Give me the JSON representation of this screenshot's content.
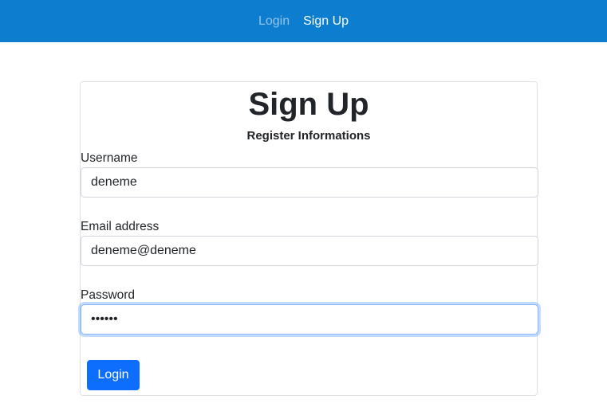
{
  "nav": {
    "login_label": "Login",
    "signup_label": "Sign Up"
  },
  "form": {
    "title": "Sign Up",
    "subtitle": "Register Informations",
    "username_label": "Username",
    "username_value": "deneme",
    "email_label": "Email address",
    "email_value": "deneme@deneme",
    "password_label": "Password",
    "password_value": "deneme",
    "submit_label": "Login"
  },
  "colors": {
    "navbar": "#0d7dd0",
    "primary_button": "#0d6efd",
    "focus_ring": "#86b7fe"
  }
}
